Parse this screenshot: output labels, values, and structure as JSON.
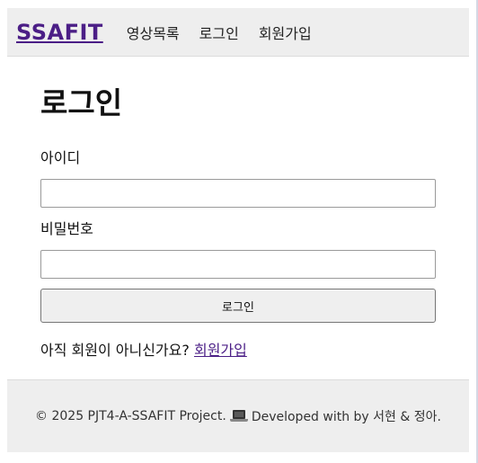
{
  "navbar": {
    "brand": "SSAFIT",
    "links": [
      "영상목록",
      "로그인",
      "회원가입"
    ]
  },
  "login": {
    "title": "로그인",
    "id_label": "아이디",
    "id_value": "",
    "password_label": "비밀번호",
    "password_value": "",
    "submit_label": "로그인",
    "signup_prompt": "아직 회원이 아니신가요?",
    "signup_link": "회원가입"
  },
  "footer": {
    "text_before_icon": "© 2025 PJT4-A-SSAFIT Project.",
    "icon": "laptop-icon",
    "text_after_icon": "Developed with by 서현 & 정아."
  },
  "colors": {
    "brand": "#4b1e86",
    "header_bg": "#eeeeee",
    "footer_bg": "#eeeeee"
  }
}
